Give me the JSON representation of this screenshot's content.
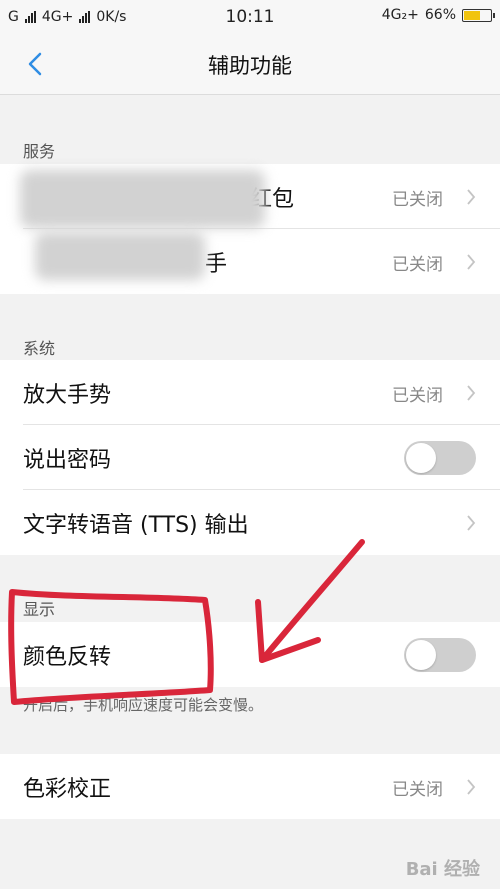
{
  "status_bar": {
    "carrier1": "G",
    "carrier2": "4G+",
    "speed": "0K/s",
    "time": "10:11",
    "network": "4G₂+",
    "battery": "66%",
    "battery_level": 66
  },
  "header": {
    "title": "辅助功能"
  },
  "sections": {
    "services": {
      "label": "服务",
      "items": [
        {
          "label": "红包",
          "value": "已关闭"
        },
        {
          "label": "手",
          "value": "已关闭"
        }
      ]
    },
    "system": {
      "label": "系统",
      "items": [
        {
          "label": "放大手势",
          "value": "已关闭"
        },
        {
          "label": "说出密码",
          "toggle": false
        },
        {
          "label": "文字转语音 (TTS) 输出"
        }
      ]
    },
    "display": {
      "label": "显示",
      "items": [
        {
          "label": "颜色反转",
          "toggle": false
        }
      ],
      "hint": "开启后，手机响应速度可能会变慢。"
    },
    "color": {
      "items": [
        {
          "label": "色彩校正",
          "value": "已关闭"
        }
      ]
    }
  },
  "colors": {
    "accent": "#2f8de4",
    "annotation": "#d9263a",
    "battery": "#f1c40f"
  },
  "watermark": "Bai 经验"
}
